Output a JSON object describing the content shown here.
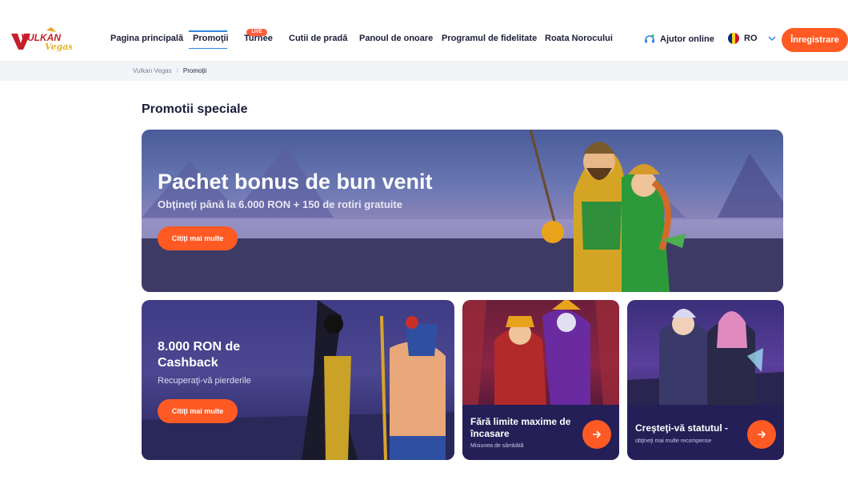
{
  "header": {
    "logo_text": "VULKAN",
    "logo_sub": "Vegas",
    "nav": [
      {
        "label": "Pagina principală"
      },
      {
        "label": "Promoţii"
      },
      {
        "label": "Turnee"
      },
      {
        "label": "Cutii de pradă"
      },
      {
        "label": "Panoul de onoare"
      },
      {
        "label": "Programul de fidelitate"
      },
      {
        "label": "Roata Norocului"
      }
    ],
    "live_badge": "LIVE",
    "help_label": "Ajutor online",
    "language": "RO",
    "register_label": "Înregistrare",
    "brand_color": "#ff5a24"
  },
  "breadcrumb": {
    "items": [
      "Vulkan Vegas",
      "Promoţii"
    ],
    "separator": "/"
  },
  "section_title": "Promotii speciale",
  "hero": {
    "title": "Pachet bonus de bun venit",
    "subtitle": "Obţineţi până la 6.000 RON + 150 de rotiri gratuite",
    "button": "Citiţi mai multe"
  },
  "cashback": {
    "title": "8.000 RON de Cashback",
    "subtitle": "Recuperaţi-vă pierderile",
    "button": "Citiţi mai multe"
  },
  "promos": [
    {
      "title": "Fără limite maxime de încasare",
      "subtitle": "Misiunea de sâmbătă"
    },
    {
      "title": "Creşteţi-vă statutul -",
      "subtitle": "obţineţi mai multe recompense"
    }
  ],
  "icons": [
    "logo-icon",
    "headset-icon",
    "romania-flag-icon",
    "chevron-down-icon",
    "arrow-right-icon"
  ]
}
